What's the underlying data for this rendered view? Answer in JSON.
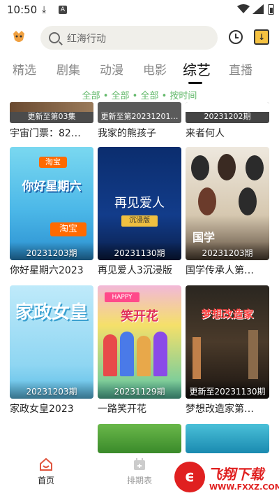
{
  "status": {
    "time": "10:50"
  },
  "search": {
    "placeholder": "红海行动"
  },
  "tabs": [
    "精选",
    "剧集",
    "动漫",
    "电影",
    "综艺",
    "直播"
  ],
  "active_tab": "综艺",
  "filter": "全部 • 全部 • 全部 • 按时间",
  "partial_row": [
    {
      "caption": "更新至第03集",
      "title": "宇宙门票：82…"
    },
    {
      "caption": "更新至第20231201…",
      "title": "我家的熊孩子"
    },
    {
      "caption": "20231202期",
      "title": "来者何人"
    }
  ],
  "cards": [
    {
      "caption": "20231203期",
      "title": "你好星期六2023",
      "poster_text": "你好星期六",
      "badge": "淘宝"
    },
    {
      "caption": "20231130期",
      "title": "再见爱人3沉浸版",
      "poster_text": "再见爱人",
      "badge": "沉浸版"
    },
    {
      "caption": "20231203期",
      "title": "国学传承人第…",
      "poster_text": "国学"
    },
    {
      "caption": "20231203期",
      "title": "家政女皇2023",
      "poster_text": "家政女皇"
    },
    {
      "caption": "20231129期",
      "title": "一路笑开花",
      "poster_text": "笑开花",
      "badge": "HAPPY"
    },
    {
      "caption": "更新至20231130期",
      "title": "梦想改造家第…",
      "poster_text": "梦想改造家"
    }
  ],
  "bottom_nav": [
    {
      "label": "首页",
      "active": true
    },
    {
      "label": "排期表",
      "active": false
    }
  ],
  "watermark": {
    "text": "飞翔下载",
    "url": "WWW.FXXZ.COM"
  },
  "colors": {
    "accent": "#63b96b",
    "active_nav": "#e0563f"
  }
}
